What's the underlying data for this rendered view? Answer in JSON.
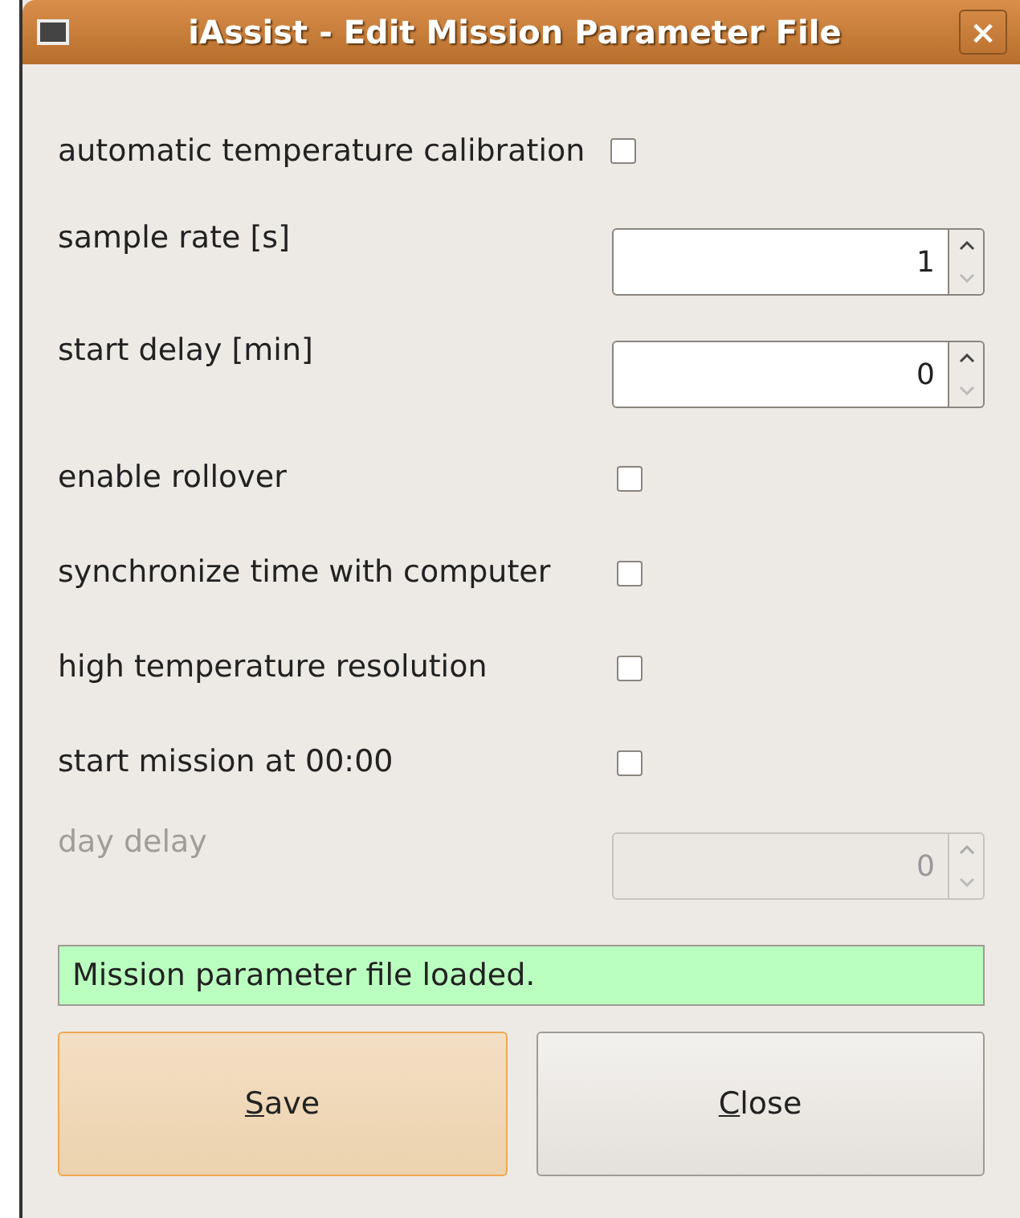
{
  "window": {
    "title": "iAssist - Edit Mission Parameter File",
    "close": "×"
  },
  "rows": [
    {
      "kind": "checkbox_inline",
      "label": "automatic temperature calibration",
      "checked": false
    },
    {
      "kind": "spin",
      "label": "sample rate [s]",
      "value": "1",
      "disabled": false
    },
    {
      "kind": "spin",
      "label": "start delay [min]",
      "value": "0",
      "disabled": false
    },
    {
      "kind": "checkbox",
      "label": "enable rollover",
      "checked": false
    },
    {
      "kind": "checkbox",
      "label": "synchronize time with computer",
      "checked": false
    },
    {
      "kind": "checkbox",
      "label": "high temperature resolution",
      "checked": false
    },
    {
      "kind": "checkbox",
      "label": "start mission at 00:00",
      "checked": false
    },
    {
      "kind": "spin",
      "label": "day delay",
      "value": "0",
      "disabled": true
    }
  ],
  "status": "Mission parameter file loaded.",
  "buttons": [
    {
      "label": "Save",
      "focused": true
    },
    {
      "label": "Close",
      "focused": false
    }
  ]
}
